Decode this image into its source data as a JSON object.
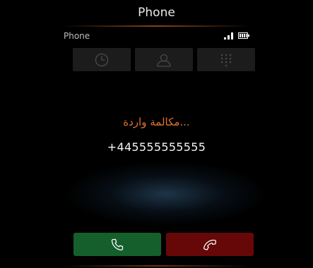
{
  "window": {
    "title": "Phone"
  },
  "status": {
    "app_name": "Phone",
    "signal_icon": "signal-bars-icon",
    "battery_icon": "battery-icon"
  },
  "tabs": [
    {
      "name": "recent-calls",
      "icon": "clock-icon"
    },
    {
      "name": "contacts",
      "icon": "person-icon"
    },
    {
      "name": "dialpad",
      "icon": "keypad-grid-icon"
    }
  ],
  "call": {
    "label": "...مكالمة واردة",
    "number": "+445555555555"
  },
  "actions": {
    "answer_icon": "phone-handset-icon",
    "decline_icon": "hang-up-handset-icon"
  },
  "colors": {
    "accent_orange": "#e0732a",
    "answer_green": "#155f2c",
    "decline_red": "#670808",
    "tab_bg": "#1c1c1c"
  }
}
